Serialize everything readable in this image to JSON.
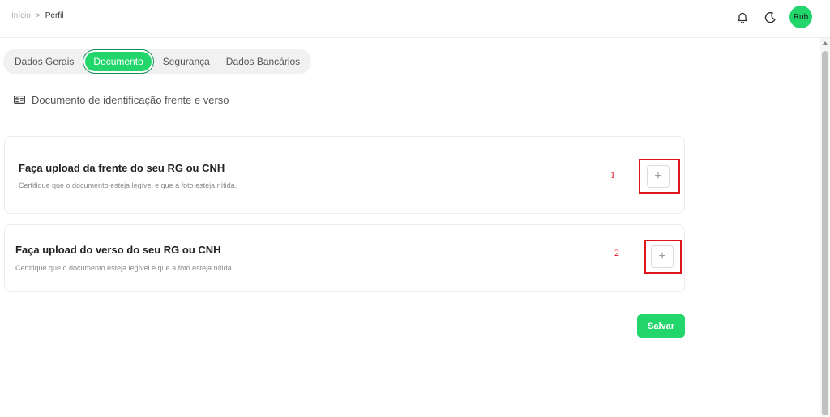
{
  "breadcrumb": {
    "home": "Início",
    "separator": ">",
    "current": "Perfil"
  },
  "header": {
    "notification_icon": "bell-icon",
    "theme_icon": "moon-icon",
    "avatar_label": "Rub",
    "accent_color": "#22d66b"
  },
  "tabs": [
    {
      "label": "Dados Gerais",
      "active": false
    },
    {
      "label": "Documento",
      "active": true
    },
    {
      "label": "Segurança",
      "active": false
    },
    {
      "label": "Dados Bancários",
      "active": false
    }
  ],
  "section": {
    "icon": "id-card-icon",
    "title": "Documento de identificação frente e verso"
  },
  "uploads": [
    {
      "title": "Faça upload da frente do seu RG ou CNH",
      "description": "Certifique que o documento esteja legível e que a foto esteja nítida.",
      "marker": "1",
      "button_icon": "plus-icon",
      "button_glyph": "+"
    },
    {
      "title": "Faça upload do verso do seu RG ou CNH",
      "description": "Certifique que o documento esteja legível e que a foto esteja nítida.",
      "marker": "2",
      "button_icon": "plus-icon",
      "button_glyph": "+"
    }
  ],
  "actions": {
    "save_label": "Salvar"
  },
  "annotation_color": "#e0141b"
}
